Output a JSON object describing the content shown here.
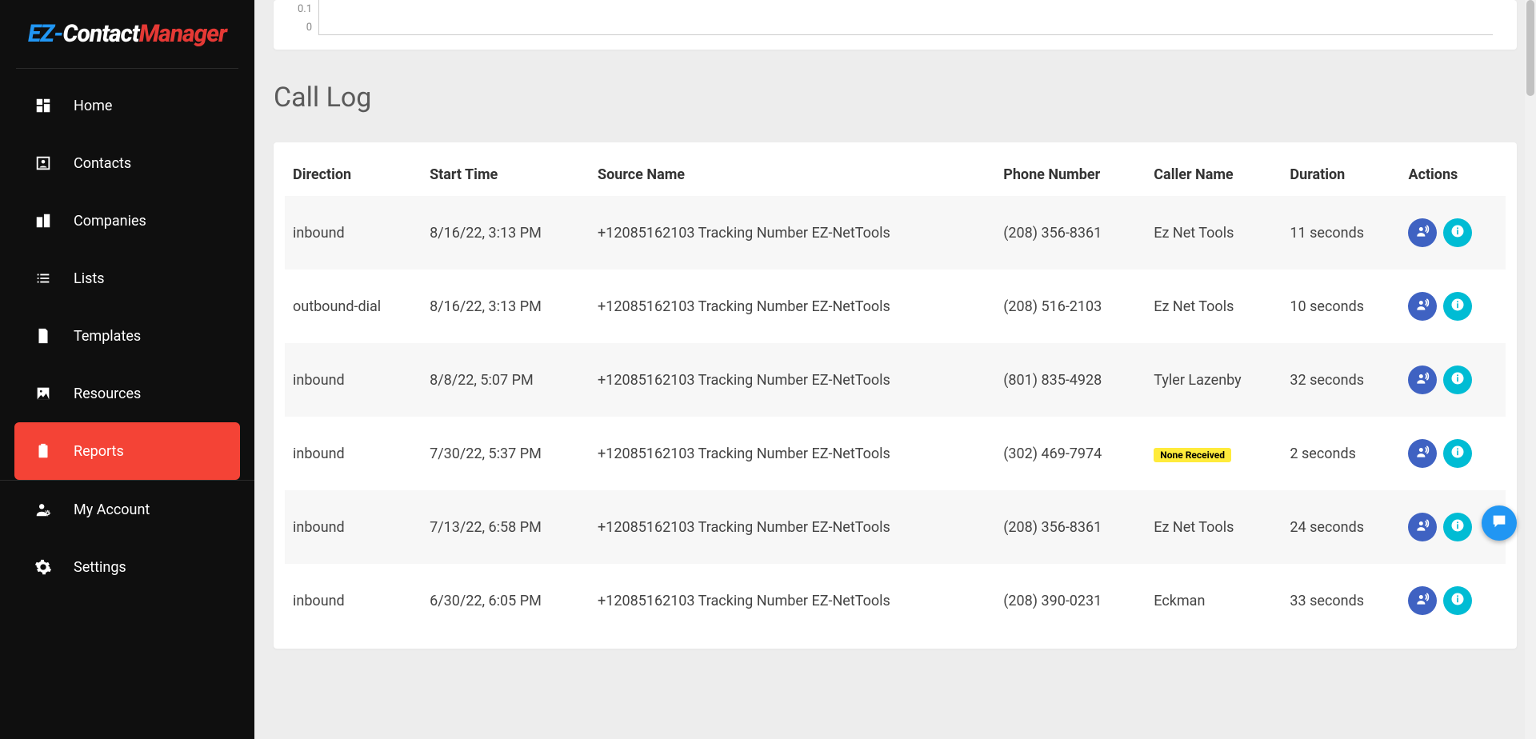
{
  "logo": {
    "ez": "EZ-",
    "contact": "Contact",
    "manager": "Manager"
  },
  "sidebar": {
    "items": [
      {
        "label": "Home",
        "icon": "dashboard-icon"
      },
      {
        "label": "Contacts",
        "icon": "person-box-icon"
      },
      {
        "label": "Companies",
        "icon": "buildings-icon"
      },
      {
        "label": "Lists",
        "icon": "list-icon"
      },
      {
        "label": "Templates",
        "icon": "document-icon"
      },
      {
        "label": "Resources",
        "icon": "image-icon"
      },
      {
        "label": "Reports",
        "icon": "clipboard-icon"
      },
      {
        "label": "My Account",
        "icon": "person-gear-icon"
      },
      {
        "label": "Settings",
        "icon": "gear-icon"
      }
    ],
    "active_index": 6,
    "divider_after_index": 6
  },
  "chart_data": {
    "type": "line",
    "ylabels_visible": [
      "0.1",
      "0"
    ],
    "ylim": [
      0,
      0.1
    ],
    "categories": [],
    "values": []
  },
  "section_title": "Call Log",
  "table": {
    "columns": [
      "Direction",
      "Start Time",
      "Source Name",
      "Phone Number",
      "Caller Name",
      "Duration",
      "Actions"
    ],
    "rows": [
      {
        "direction": "inbound",
        "start": "8/16/22, 3:13 PM",
        "source": "+12085162103 Tracking Number EZ-NetTools",
        "phone": "(208) 356-8361",
        "caller": "Ez Net Tools",
        "caller_badge": false,
        "duration": "11 seconds"
      },
      {
        "direction": "outbound-dial",
        "start": "8/16/22, 3:13 PM",
        "source": "+12085162103 Tracking Number EZ-NetTools",
        "phone": "(208) 516-2103",
        "caller": "Ez Net Tools",
        "caller_badge": false,
        "duration": "10 seconds"
      },
      {
        "direction": "inbound",
        "start": "8/8/22, 5:07 PM",
        "source": "+12085162103 Tracking Number EZ-NetTools",
        "phone": "(801) 835-4928",
        "caller": "Tyler Lazenby",
        "caller_badge": false,
        "duration": "32 seconds"
      },
      {
        "direction": "inbound",
        "start": "7/30/22, 5:37 PM",
        "source": "+12085162103 Tracking Number EZ-NetTools",
        "phone": "(302) 469-7974",
        "caller": "None Received",
        "caller_badge": true,
        "duration": "2 seconds"
      },
      {
        "direction": "inbound",
        "start": "7/13/22, 6:58 PM",
        "source": "+12085162103 Tracking Number EZ-NetTools",
        "phone": "(208) 356-8361",
        "caller": "Ez Net Tools",
        "caller_badge": false,
        "duration": "24 seconds"
      },
      {
        "direction": "inbound",
        "start": "6/30/22, 6:05 PM",
        "source": "+12085162103 Tracking Number EZ-NetTools",
        "phone": "(208) 390-0231",
        "caller": "Eckman",
        "caller_badge": false,
        "duration": "33 seconds"
      }
    ]
  }
}
